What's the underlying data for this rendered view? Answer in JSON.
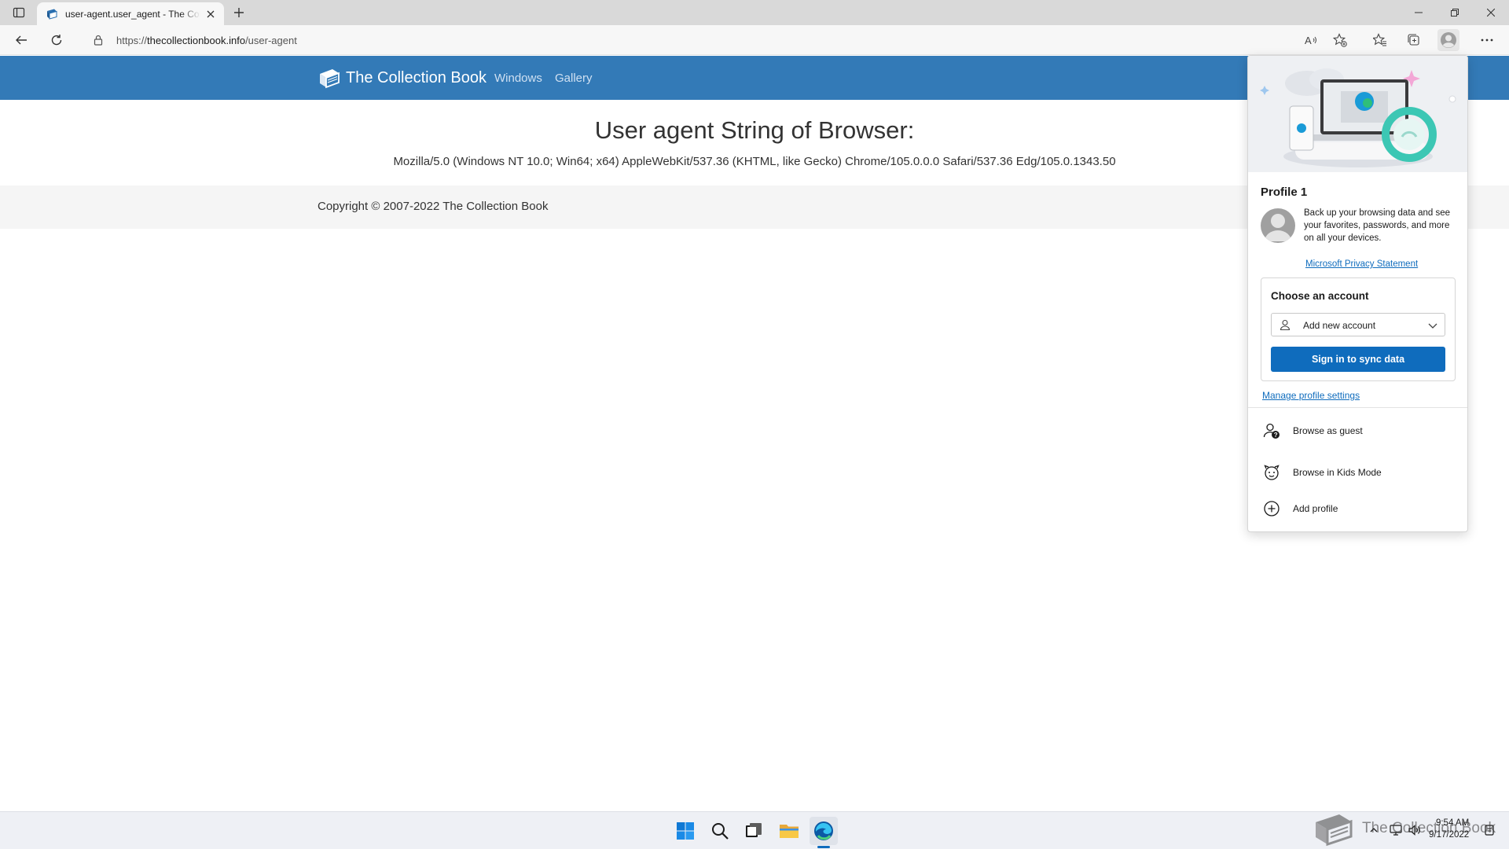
{
  "browser": {
    "tab_title": "user-agent.user_agent - The Collection Book",
    "url_scheme": "https://",
    "url_host": "thecollectionbook.info",
    "url_path": "/user-agent"
  },
  "site": {
    "brand": "The Collection Book",
    "nav_links": [
      "Windows",
      "Gallery"
    ],
    "heading": "User agent String of Browser:",
    "user_agent": "Mozilla/5.0 (Windows NT 10.0; Win64; x64) AppleWebKit/537.36 (KHTML, like Gecko) Chrome/105.0.0.0 Safari/537.36 Edg/105.0.1343.50",
    "copyright": "Copyright © 2007-2022 The Collection Book",
    "nav_bg_color": "#337ab7"
  },
  "profile_flyout": {
    "profile_name": "Profile 1",
    "backup_text": "Back up your browsing data and see your favorites, passwords, and more on all your devices.",
    "privacy_link": "Microsoft Privacy Statement",
    "choose_account_label": "Choose an account",
    "account_select_value": "Add new account",
    "sign_in_button": "Sign in to sync data",
    "manage_link": "Manage profile settings",
    "items": [
      {
        "label": "Browse as guest",
        "icon": "guest-icon"
      },
      {
        "label": "Browse in Kids Mode",
        "icon": "kids-mode-icon"
      },
      {
        "label": "Add profile",
        "icon": "add-circle-icon"
      }
    ],
    "accent_color": "#0f6cbd"
  },
  "taskbar": {
    "time": "9:54 AM",
    "date": "9/17/2022",
    "apps": [
      "start-icon",
      "search-icon",
      "task-view-icon",
      "file-explorer-icon",
      "edge-icon"
    ]
  },
  "watermark": "The Collection Book"
}
